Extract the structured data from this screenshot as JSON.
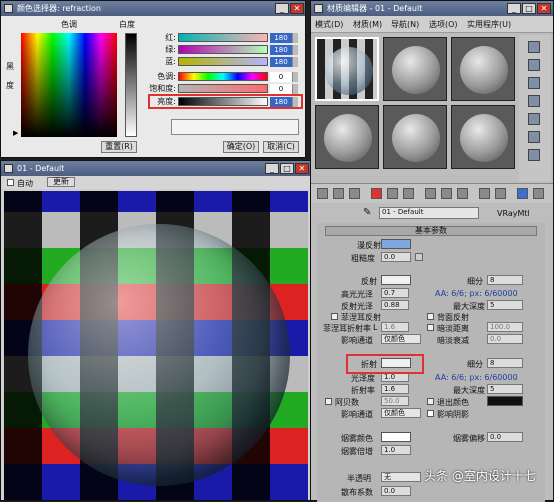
{
  "picker": {
    "title": "颜色选择器: refraction",
    "hue_label": "色调",
    "white_label": "白度",
    "black_label_1": "黑",
    "black_label_2": "度",
    "rows": [
      {
        "label": "红:",
        "value": "180"
      },
      {
        "label": "绿:",
        "value": "180"
      },
      {
        "label": "蓝:",
        "value": "180"
      },
      {
        "label": "色调:",
        "value": "0"
      },
      {
        "label": "饱和度:",
        "value": "0"
      },
      {
        "label": "亮度:",
        "value": "180"
      }
    ],
    "reset": "重置(R)",
    "ok": "确定(O)",
    "cancel": "取消(C)"
  },
  "sample": {
    "title": "01 - Default",
    "auto": "自动",
    "update": "更新"
  },
  "mated": {
    "title": "材质编辑器 - 01 - Default",
    "menu": [
      "模式(D)",
      "材质(M)",
      "导航(N)",
      "选项(O)",
      "实用程序(U)"
    ],
    "material_name": "01 - Default",
    "material_type": "VRayMtl",
    "rollout": "基本参数",
    "diffuse": "漫反射",
    "roughness": "粗糙度",
    "roughness_val": "0.0",
    "reflect": "反射",
    "subdivs": "细分",
    "subdivs_val": "8",
    "hilight": "高光光泽",
    "hilight_val": "0.7",
    "aa1": "AA: 6/6; px: 6/60000",
    "refl_gloss": "反射光泽",
    "refl_gloss_val": "0.88",
    "max_depth": "最大深度",
    "max_depth_val": "5",
    "fresnel": "菲涅耳反射",
    "back_refl": "背面反射",
    "fresnel_ior": "菲涅耳折射率",
    "fresnel_ior_l": "L",
    "fresnel_ior_val": "1.6",
    "dim_dist": "暗淡距离",
    "dim_dist_val": "100.0",
    "affect_ch": "影响通道",
    "affect_ch_val": "仅颜色",
    "dim_falloff": "暗淡衰减",
    "dim_falloff_val": "0.0",
    "refract": "折射",
    "subdivs2": "细分",
    "subdivs2_val": "8",
    "gloss": "光泽度",
    "gloss_val": "1.0",
    "aa2": "AA: 6/6; px: 6/60000",
    "ior": "折射率",
    "ior_val": "1.6",
    "max_depth2": "最大深度",
    "max_depth2_val": "5",
    "abbe": "阿贝数",
    "abbe_val": "50.0",
    "exit_color": "退出颜色",
    "affect_ch2": "影响通道",
    "affect_ch2_val": "仅颜色",
    "affect_shadow": "影响阴影",
    "fog_color": "烟雾颜色",
    "fog_bias": "烟雾偏移",
    "fog_bias_val": "0.0",
    "fog_mult": "烟雾倍增",
    "fog_mult_val": "1.0",
    "translucency": "半透明",
    "translucency_val": "无",
    "scatter": "散布系数",
    "scatter_val": "0.0"
  },
  "watermark": "头条 @室内设计十七"
}
